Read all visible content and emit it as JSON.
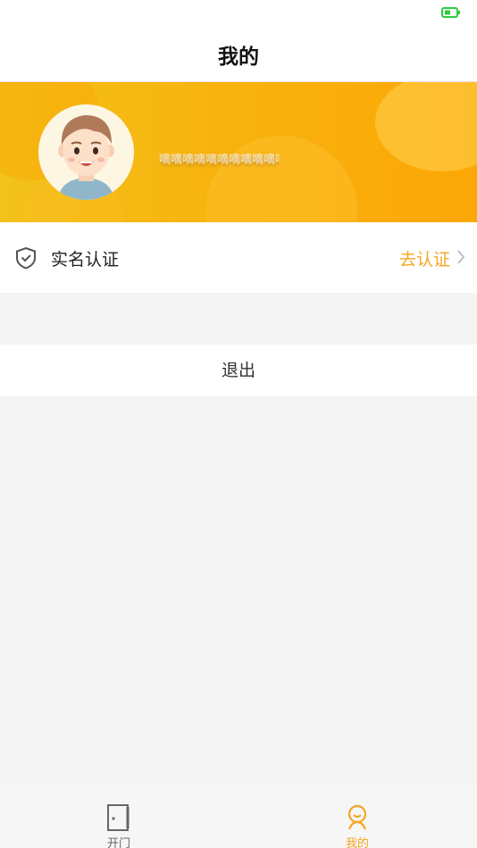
{
  "nav": {
    "title": "我的"
  },
  "profile": {
    "username": "嘀嘀嘀嘀嘀嘀嘀嘀嘀嘀嘀嘀嘀"
  },
  "verification": {
    "label": "实名认证",
    "action": "去认证"
  },
  "logout": {
    "label": "退出"
  },
  "tabs": [
    {
      "label": "开门",
      "icon": "door-icon",
      "active": false
    },
    {
      "label": "我的",
      "icon": "person-icon",
      "active": true
    }
  ],
  "colors": {
    "accent": "#f5a623",
    "banner_start": "#f2c21a",
    "banner_end": "#fba706",
    "battery": "#2ecc40"
  }
}
